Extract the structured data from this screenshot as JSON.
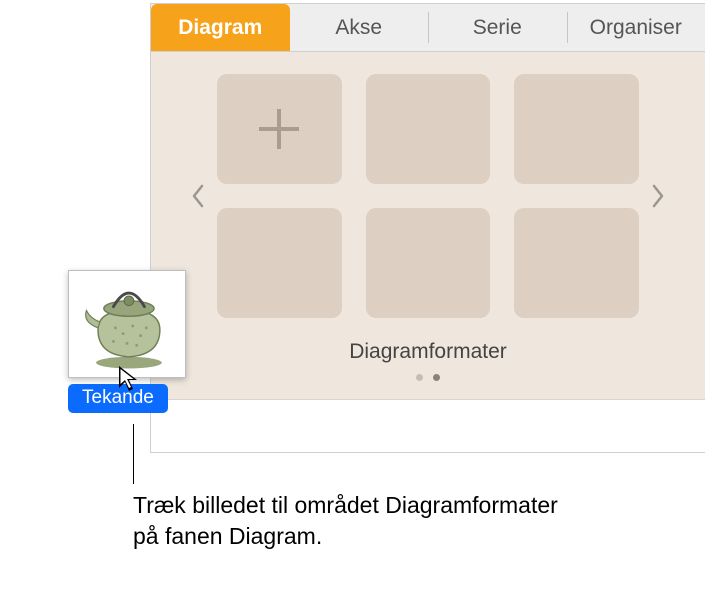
{
  "tabs": {
    "diagram": "Diagram",
    "akse": "Akse",
    "serie": "Serie",
    "organiser": "Organiser"
  },
  "styles": {
    "caption": "Diagramformater"
  },
  "drag": {
    "label": "Tekande"
  },
  "callout": {
    "text": "Træk billedet til området Diagramformater på fanen Diagram."
  }
}
